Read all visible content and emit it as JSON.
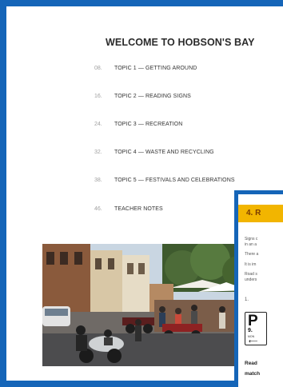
{
  "title": "WELCOME TO HOBSON'S BAY",
  "toc": [
    {
      "page": "08.",
      "label": "TOPIC 1 — GETTING AROUND"
    },
    {
      "page": "16.",
      "label": "TOPIC 2 — READING SIGNS"
    },
    {
      "page": "24.",
      "label": "TOPIC 3 — RECREATION"
    },
    {
      "page": "32.",
      "label": "TOPIC 4 — WASTE AND RECYCLING"
    },
    {
      "page": "38.",
      "label": "TOPIC 5 — FESTIVALS AND CELEBRATIONS"
    },
    {
      "page": "46.",
      "label": "TEACHER NOTES"
    }
  ],
  "inset": {
    "banner": "4. R",
    "line1": "Signs c",
    "line2": "in an a",
    "line3": "There a",
    "line4": "It is im",
    "line5": "Road s",
    "line6": "unders",
    "item_number": "1.",
    "sign_letter": "P",
    "sign_time": "9.",
    "sign_day": "MON",
    "sign_arrow": "⟵",
    "bold1": "Read",
    "bold2": "match"
  },
  "colors": {
    "frame_blue": "#1565b8",
    "banner_yellow": "#f2b500"
  }
}
